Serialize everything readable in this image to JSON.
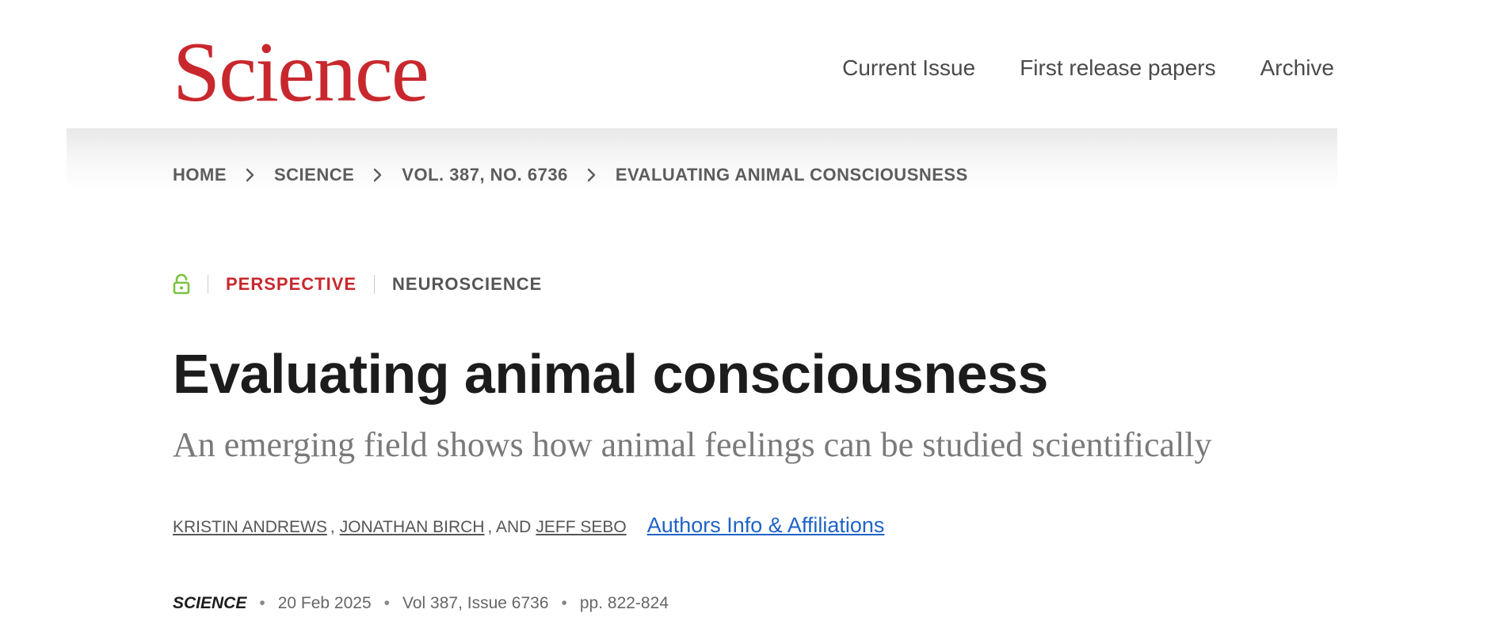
{
  "header": {
    "logo": "Science",
    "nav": [
      "Current Issue",
      "First release papers",
      "Archive"
    ]
  },
  "breadcrumb": {
    "items": [
      "HOME",
      "SCIENCE",
      "VOL. 387, NO. 6736"
    ],
    "current": "EVALUATING ANIMAL CONSCIOUSNESS"
  },
  "article": {
    "access_icon": "unlock-icon",
    "type": "PERSPECTIVE",
    "subject": "NEUROSCIENCE",
    "title": "Evaluating animal consciousness",
    "subtitle": "An emerging field shows how animal feelings can be studied scientifically",
    "authors": [
      "KRISTIN ANDREWS",
      "JONATHAN BIRCH",
      "JEFF SEBO"
    ],
    "author_sep_comma": ",",
    "author_sep_and": ", AND",
    "affiliations_link": "Authors Info & Affiliations",
    "citation": {
      "journal": "SCIENCE",
      "date": "20 Feb 2025",
      "volume_issue": "Vol 387, Issue 6736",
      "pages": "pp. 822-824",
      "separator": "•"
    }
  },
  "colors": {
    "brand": "#c8282d",
    "link": "#1f63c6",
    "open_access": "#7cc242"
  }
}
